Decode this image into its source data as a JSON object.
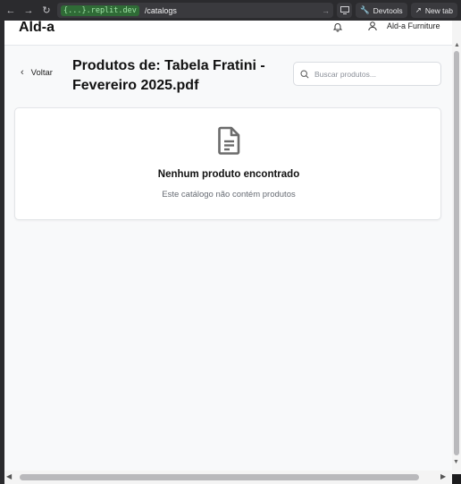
{
  "browser": {
    "back_icon": "←",
    "forward_icon": "→",
    "reload_icon": "↻",
    "url_host": "{...}.replit.dev",
    "url_path": "/catalogs",
    "devtools_label": "Devtools",
    "newtab_label": "New tab"
  },
  "header": {
    "brand": "Ald-a",
    "user_name": "Ald-a Furniture"
  },
  "page": {
    "back_label": "Voltar",
    "title": "Produtos de: Tabela Fratini - Fevereiro 2025.pdf",
    "search_placeholder": "Buscar produtos..."
  },
  "empty_state": {
    "icon": "document-icon",
    "title": "Nenhum produto encontrado",
    "subtitle": "Este catálogo não contém produtos"
  },
  "colors": {
    "background": "#f8f9fa",
    "card": "#ffffff",
    "browser_chrome": "#2b2b2e",
    "url_host_bg": "#2f6b36"
  }
}
